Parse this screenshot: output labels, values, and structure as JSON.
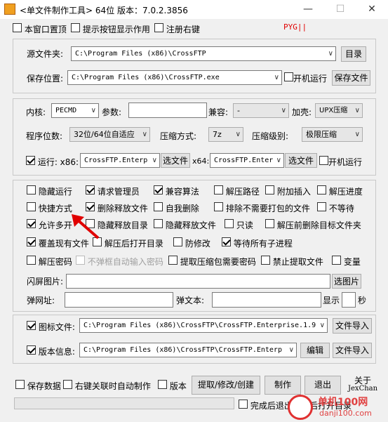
{
  "title": "<单文件制作工具> 64位 版本：7.0.2.3856",
  "top_options": [
    {
      "label": "本窗口置顶",
      "checked": false
    },
    {
      "label": "提示按钮显示作用",
      "checked": false
    },
    {
      "label": "注册右键",
      "checked": false
    }
  ],
  "pyg": "PYG||",
  "source": {
    "label": "源文件夹:",
    "value": "C:\\Program Files (x86)\\CrossFTP",
    "dir_button": "目录"
  },
  "save": {
    "label": "保存位置:",
    "value": "C:\\Program Files (x86)\\CrossFTP.exe",
    "autorun": "开机运行",
    "button": "保存文件"
  },
  "core": {
    "label": "内核:",
    "value": "PECMD",
    "param_label": "参数:",
    "compat_label": "兼容:",
    "compat_value": "-",
    "shell_label": "加壳:",
    "shell_value": "UPX压缩"
  },
  "bits": {
    "label": "程序位数:",
    "value": "32位/64位自适应",
    "method_label": "压缩方式:",
    "method_value": "7z",
    "level_label": "压缩级别:",
    "level_value": "极限压缩"
  },
  "run": {
    "label": "运行: x86:",
    "x86_value": "CrossFTP.Enterp",
    "select1": "选文件",
    "x64_label": "x64:",
    "x64_value": "CrossFTP.Enter",
    "select2": "选文件",
    "autorun": "开机运行"
  },
  "options": [
    [
      {
        "label": "隐藏运行",
        "checked": false
      },
      {
        "label": "请求管理员",
        "checked": true
      },
      {
        "label": "兼容算法",
        "checked": true
      },
      {
        "label": "解压路径",
        "checked": false
      },
      {
        "label": "附加插入",
        "checked": false
      },
      {
        "label": "解压进度",
        "checked": false
      }
    ],
    [
      {
        "label": "快捷方式",
        "checked": false
      },
      {
        "label": "删除释放文件",
        "checked": true
      },
      {
        "label": "自我删除",
        "checked": false
      },
      {
        "label": "排除不需要打包的文件",
        "checked": false
      },
      {
        "label": "不等待",
        "checked": false
      }
    ],
    [
      {
        "label": "允许多开",
        "checked": true
      },
      {
        "label": "隐藏释放目录",
        "checked": false
      },
      {
        "label": "隐藏释放文件",
        "checked": false
      },
      {
        "label": "只读",
        "checked": false
      },
      {
        "label": "解压前删除目标文件夹",
        "checked": false
      }
    ],
    [
      {
        "label": "覆盖现有文件",
        "checked": true
      },
      {
        "label": "解压后打开目录",
        "checked": false
      },
      {
        "label": "防修改",
        "checked": false
      },
      {
        "label": "等待所有子进程",
        "checked": true
      }
    ],
    [
      {
        "label": "解压密码",
        "checked": false
      },
      {
        "label": "不弹框自动输入密码",
        "checked": false,
        "disabled": true
      },
      {
        "label": "提取压缩包需要密码",
        "checked": false
      },
      {
        "label": "禁止提取文件",
        "checked": false
      },
      {
        "label": "变量",
        "checked": false
      }
    ]
  ],
  "splash": {
    "label": "闪屏图片:",
    "button": "选图片"
  },
  "popup": {
    "url_label": "弹网址:",
    "text_label": "弹文本:",
    "show_label": "显示",
    "seconds_label": "秒"
  },
  "icon_file": {
    "label": "图标文件:",
    "value": "C:\\Program Files (x86)\\CrossFTP\\CrossFTP.Enterprise.1.9",
    "button": "文件导入",
    "checked": true
  },
  "version_info": {
    "label": "版本信息:",
    "value": "C:\\Program Files (x86)\\CrossFTP\\CrossFTP.Enterp",
    "edit_button": "编辑",
    "import_button": "文件导入",
    "checked": true
  },
  "bottom": {
    "save_data": "保存数据",
    "right_click": "右键关联时自动制作",
    "version": "版本",
    "extract_button": "提取/修改/创建",
    "make_button": "制作",
    "exit_button": "退出",
    "about": "关于",
    "author": "JexChan"
  },
  "status": {
    "exit_after": "完成后退出",
    "open_after": "后打开目录"
  },
  "watermark": {
    "site": "单机100网",
    "url": "danji100.com"
  }
}
